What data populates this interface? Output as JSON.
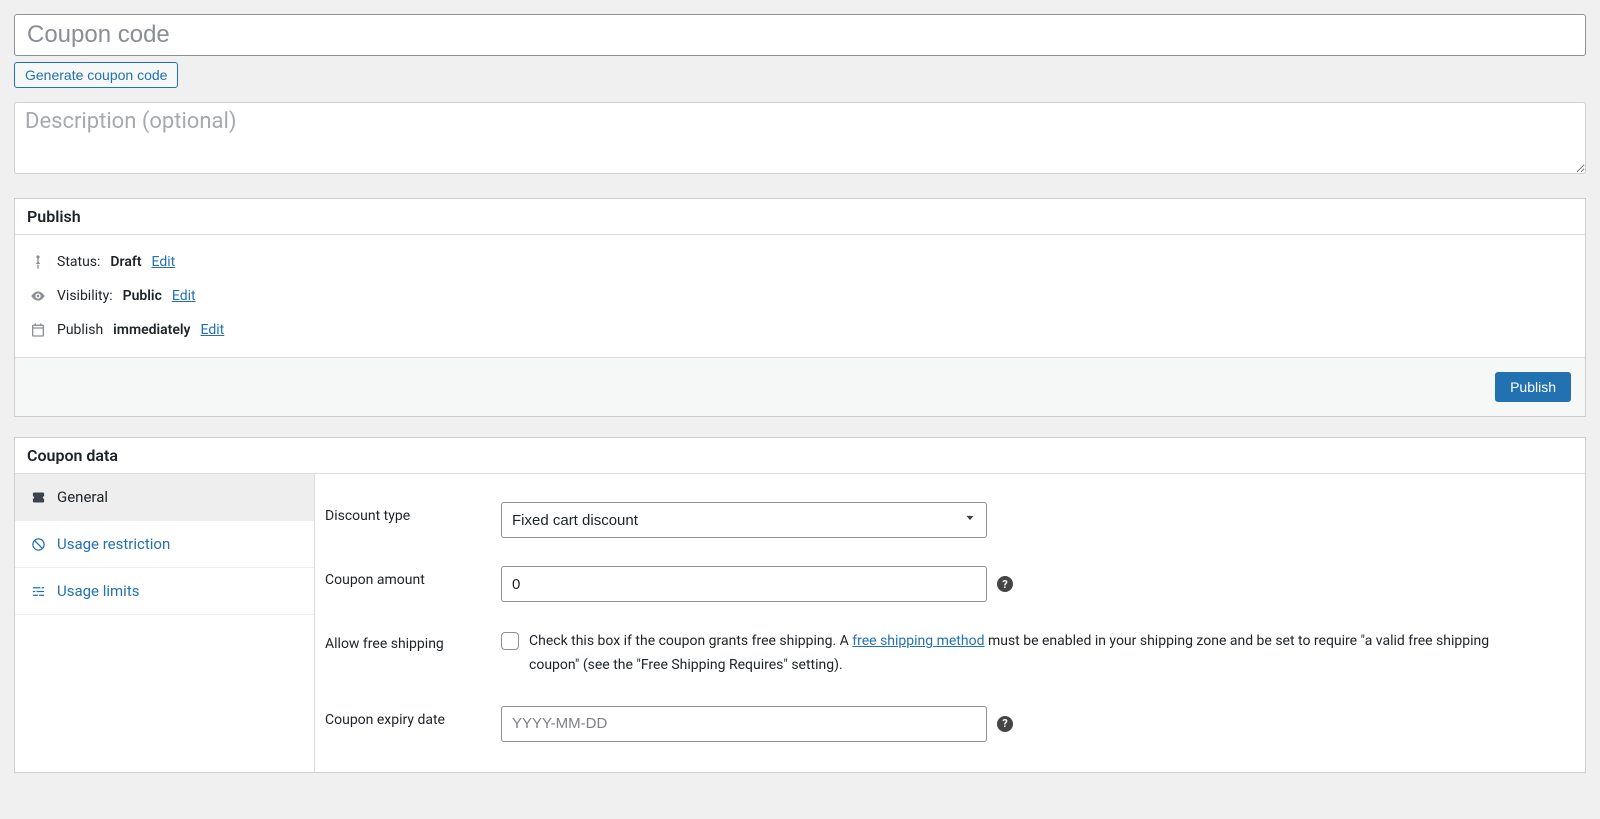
{
  "title": {
    "placeholder": "Coupon code",
    "value": ""
  },
  "generate_button_label": "Generate coupon code",
  "description": {
    "placeholder": "Description (optional)",
    "value": ""
  },
  "publish_box": {
    "title": "Publish",
    "status_label": "Status:",
    "status_value": "Draft",
    "status_edit": "Edit",
    "visibility_label": "Visibility:",
    "visibility_value": "Public",
    "visibility_edit": "Edit",
    "publish_label": "Publish",
    "publish_value": "immediately",
    "publish_edit": "Edit",
    "publish_button": "Publish"
  },
  "coupon_box": {
    "title": "Coupon data",
    "tabs": {
      "general": "General",
      "usage_restriction": "Usage restriction",
      "usage_limits": "Usage limits"
    },
    "fields": {
      "discount_type": {
        "label": "Discount type",
        "selected": "Fixed cart discount"
      },
      "coupon_amount": {
        "label": "Coupon amount",
        "value": "0"
      },
      "allow_free_shipping": {
        "label": "Allow free shipping",
        "text_before": "Check this box if the coupon grants free shipping. A ",
        "link_text": "free shipping method",
        "text_after": " must be enabled in your shipping zone and be set to require \"a valid free shipping coupon\" (see the \"Free Shipping Requires\" setting)."
      },
      "coupon_expiry_date": {
        "label": "Coupon expiry date",
        "placeholder": "YYYY-MM-DD",
        "value": ""
      }
    }
  }
}
